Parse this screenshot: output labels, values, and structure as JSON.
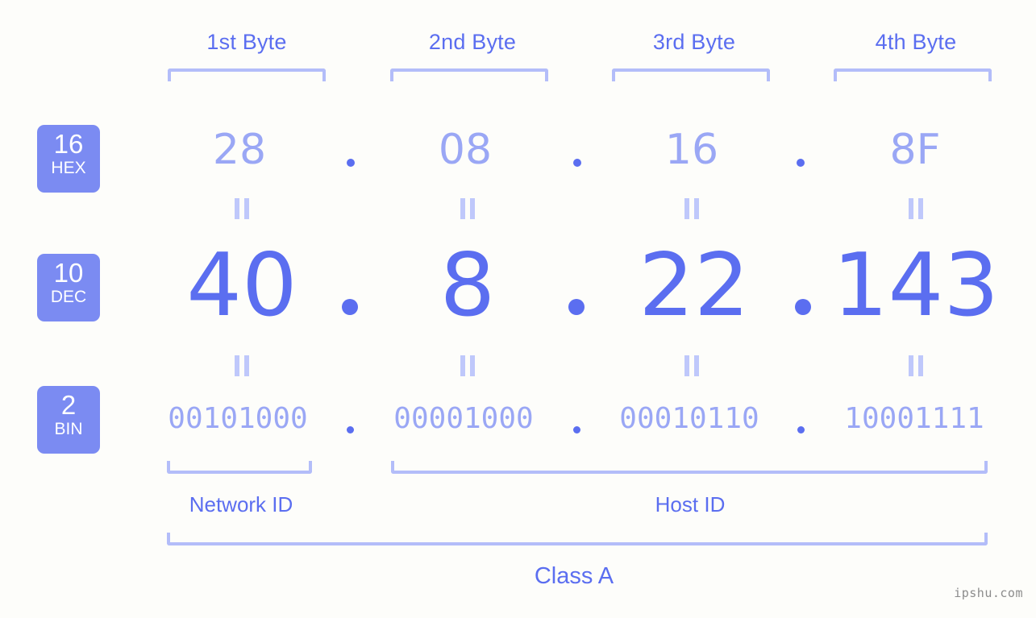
{
  "meta": {
    "background": "#fdfdfa",
    "accent_strong": "#5b6ef0",
    "accent_light": "#9aa7f5",
    "bracket_color": "#b3bdf9",
    "badge_bg": "#7b8bf2",
    "watermark": "ipshu.com"
  },
  "byte_headers": [
    {
      "label": "1st Byte"
    },
    {
      "label": "2nd Byte"
    },
    {
      "label": "3rd Byte"
    },
    {
      "label": "4th Byte"
    }
  ],
  "rows": {
    "hex": {
      "badge_num": "16",
      "badge_label": "HEX",
      "values": [
        "28",
        "08",
        "16",
        "8F"
      ],
      "separator": "."
    },
    "dec": {
      "badge_num": "10",
      "badge_label": "DEC",
      "values": [
        "40",
        "8",
        "22",
        "143"
      ],
      "separator": "."
    },
    "bin": {
      "badge_num": "2",
      "badge_label": "BIN",
      "values": [
        "00101000",
        "00001000",
        "00010110",
        "10001111"
      ],
      "separator": "."
    }
  },
  "equals_marks": {
    "glyph": "||"
  },
  "sections": {
    "network_id": "Network ID",
    "host_id": "Host ID",
    "class": "Class A"
  },
  "ip": {
    "dotted_decimal": "40.8.22.143",
    "hex": "28.08.16.8F",
    "binary": "00101000.00001000.00010110.10001111"
  }
}
